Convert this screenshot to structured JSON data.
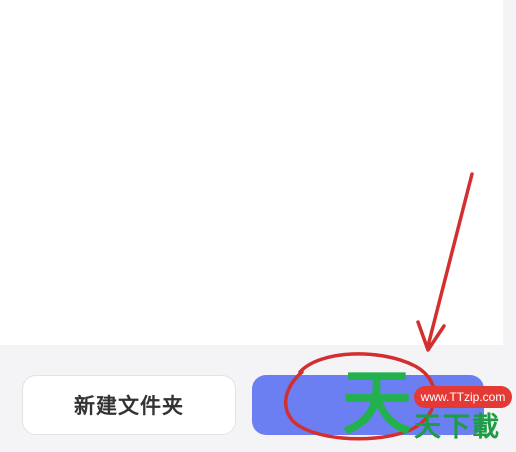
{
  "footer": {
    "new_folder_label": "新建文件夹",
    "confirm_label": ""
  },
  "watermark": {
    "big_char": "天",
    "small_text": "天下載",
    "url": "www.TTzip.com"
  },
  "colors": {
    "primary_button": "#6b7ff2",
    "annotation": "#d32f2f",
    "watermark_green": "#22b14c"
  }
}
